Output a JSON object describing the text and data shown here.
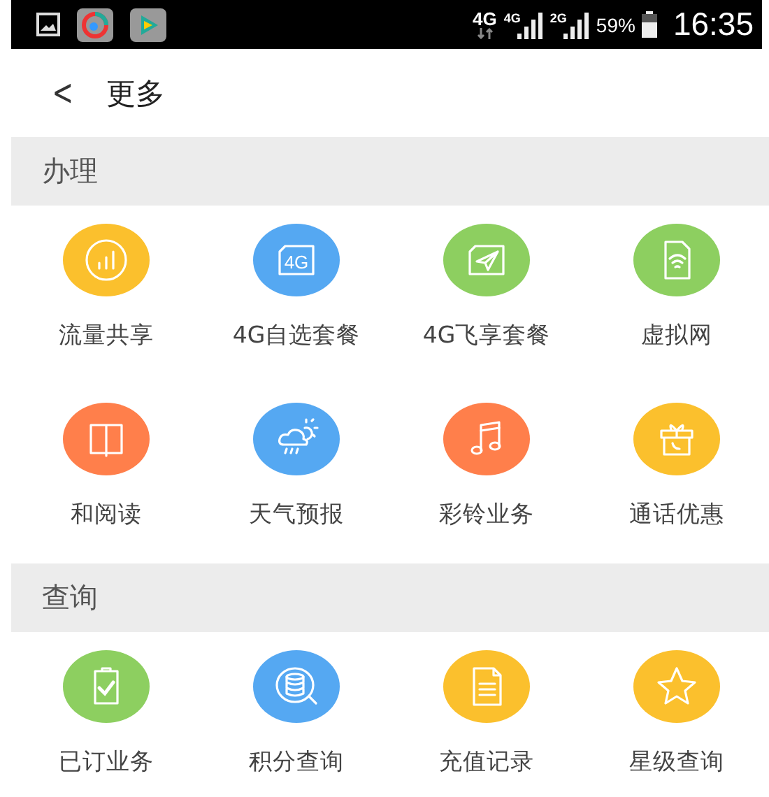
{
  "status_bar": {
    "network": "4G",
    "sim_1": "4G",
    "sim_2": "2G",
    "battery": "59%",
    "time": "16:35"
  },
  "header": {
    "back": "<",
    "title": "更多"
  },
  "sections": [
    {
      "title": "办理",
      "items": [
        {
          "label": "流量共享",
          "kind": "chart",
          "color": "#fbc02d"
        },
        {
          "label": "4G自选套餐",
          "kind": "sim",
          "color": "#55a8f2",
          "icon_text": "4G"
        },
        {
          "label": "4G飞享套餐",
          "kind": "plane",
          "color": "#8dcf60"
        },
        {
          "label": "虚拟网",
          "kind": "wifi-doc",
          "color": "#8dcf60"
        },
        {
          "label": "和阅读",
          "kind": "book",
          "color": "#ff7f4b"
        },
        {
          "label": "天气预报",
          "kind": "weather",
          "color": "#55a8f2"
        },
        {
          "label": "彩铃业务",
          "kind": "music",
          "color": "#ff7f4b"
        },
        {
          "label": "通话优惠",
          "kind": "gift",
          "color": "#fbc02d"
        }
      ]
    },
    {
      "title": "查询",
      "items": [
        {
          "label": "已订业务",
          "kind": "clipboard",
          "color": "#8dcf60"
        },
        {
          "label": "积分查询",
          "kind": "coins",
          "color": "#55a8f2"
        },
        {
          "label": "充值记录",
          "kind": "document",
          "color": "#fbc02d"
        },
        {
          "label": "星级查询",
          "kind": "star",
          "color": "#fbc02d"
        }
      ]
    }
  ]
}
